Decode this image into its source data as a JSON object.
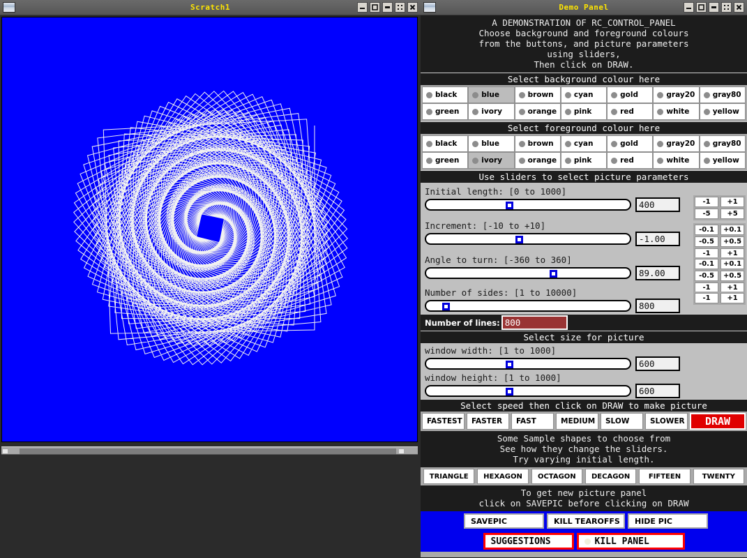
{
  "windows": {
    "left": {
      "title": "Scratch1",
      "buttons": [
        "minimize-icon",
        "maximize-icon",
        "shade-icon",
        "resize-icon",
        "close-icon"
      ]
    },
    "right": {
      "title": "Demo Panel",
      "buttons": [
        "minimize-icon",
        "maximize-icon",
        "shade-icon",
        "resize-icon",
        "close-icon"
      ]
    }
  },
  "canvas": {
    "background_colour": "#0000ff",
    "foreground_colour": "#fffff0"
  },
  "header": {
    "lines": [
      "A DEMONSTRATION OF RC_CONTROL_PANEL",
      "Choose background and foreground colours",
      "from the buttons, and picture parameters",
      "using sliders,",
      "Then click on DRAW."
    ]
  },
  "background_section": {
    "title": "Select background colour here",
    "selected": "blue",
    "rows": [
      [
        "black",
        "blue",
        "brown",
        "cyan",
        "gold",
        "gray20",
        "gray80"
      ],
      [
        "green",
        "ivory",
        "orange",
        "pink",
        "red",
        "white",
        "yellow"
      ]
    ]
  },
  "foreground_section": {
    "title": "Select foreground colour here",
    "selected": "ivory",
    "rows": [
      [
        "black",
        "blue",
        "brown",
        "cyan",
        "gold",
        "gray20",
        "gray80"
      ],
      [
        "green",
        "ivory",
        "orange",
        "pink",
        "red",
        "white",
        "yellow"
      ]
    ]
  },
  "sliders_section": {
    "title": "Use sliders to select picture parameters",
    "items": [
      {
        "label": "Initial length: [0 to 1000]",
        "value": "400",
        "min": 0,
        "max": 1000,
        "percent": 40,
        "steps": [
          [
            "-1",
            "+1"
          ],
          [
            "-5",
            "+5"
          ]
        ]
      },
      {
        "label": "Increment: [-10 to +10]",
        "value": "-1.00",
        "min": -10,
        "max": 10,
        "percent": 45,
        "steps": [
          [
            "-0.1",
            "+0.1"
          ],
          [
            "-0.5",
            "+0.5"
          ],
          [
            "-1",
            "+1"
          ]
        ]
      },
      {
        "label": "Angle to turn: [-360 to 360]",
        "value": "89.00",
        "min": -360,
        "max": 360,
        "percent": 62,
        "steps": [
          [
            "-0.1",
            "+0.1"
          ],
          [
            "-0.5",
            "+0.5"
          ],
          [
            "-1",
            "+1"
          ]
        ]
      },
      {
        "label": "Number of sides: [1 to 10000]",
        "value": "800",
        "min": 1,
        "max": 10000,
        "percent": 8,
        "steps": [
          [
            "-1",
            "+1"
          ]
        ]
      }
    ]
  },
  "lines_field": {
    "label": "Number of lines:",
    "value": "800",
    "field_colour": "#993333"
  },
  "size_section": {
    "title": "Select size for picture",
    "items": [
      {
        "label": "window width: [1 to 1000]",
        "value": "600",
        "percent": 40
      },
      {
        "label": "window height: [1 to 1000]",
        "value": "600",
        "percent": 40
      }
    ]
  },
  "speed_section": {
    "title": "Select speed then click on DRAW to make picture",
    "speeds": [
      "FASTEST",
      "FASTER",
      "FAST",
      "MEDIUM",
      "SLOW",
      "SLOWER"
    ],
    "draw_label": "DRAW",
    "draw_colour": "#e00000"
  },
  "samples_section": {
    "lines": [
      "Some Sample shapes to choose from",
      "See how they change the sliders.",
      "Try varying initial length."
    ],
    "shapes": [
      "TRIANGLE",
      "HEXAGON",
      "OCTAGON",
      "DECAGON",
      "FIFTEEN",
      "TWENTY"
    ]
  },
  "savepic_section": {
    "lines": [
      "To get new picture panel",
      "click on SAVEPIC before clicking on DRAW"
    ],
    "buttons": [
      "SAVEPIC",
      "KILL TEAROFFS",
      "HIDE PIC"
    ],
    "danger_buttons": [
      "SUGGESTIONS",
      "KILL PANEL"
    ]
  }
}
